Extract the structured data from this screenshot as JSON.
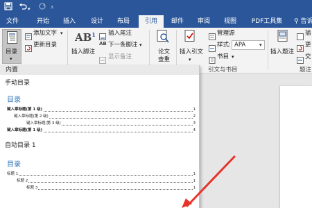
{
  "titlebar": {
    "save_icon": "save-icon",
    "undo_icon": "undo-icon",
    "redo_icon": "redo-icon",
    "customize_icon": "customize-icon",
    "brand_color": "#2b579a"
  },
  "tabs": [
    {
      "label": "文件"
    },
    {
      "label": "开始"
    },
    {
      "label": "插入"
    },
    {
      "label": "设计"
    },
    {
      "label": "布局"
    },
    {
      "label": "引用",
      "active": true
    },
    {
      "label": "邮件"
    },
    {
      "label": "审阅"
    },
    {
      "label": "视图"
    },
    {
      "label": "PDF工具集"
    }
  ],
  "tell_me": "告诉",
  "ribbon": {
    "toc_button": "目录",
    "add_text": "添加文字",
    "update_toc": "更新目录",
    "insert_footnote": "插入脚注",
    "insert_endnote": "插入尾注",
    "next_footnote": "下一条脚注",
    "show_notes": "显示备注",
    "ab_label": "AB",
    "ab_sup": "1",
    "ab_small": "AB",
    "search_l1": "论文",
    "search_l2": "查重",
    "insert_citation": "插入引文",
    "manage_sources": "管理源",
    "style_label": "样式:",
    "style_value": "APA",
    "bibliography": "书目",
    "citations_group": "引文与书目",
    "insert_caption": "插入题注",
    "captions_group": "题注",
    "insert_table_figures": "插",
    "update_table": "更",
    "cross_ref": "交"
  },
  "toc_panel": {
    "builtin_header": "内置",
    "manual_name": "手动目录",
    "manual_heading": "目录",
    "manual_lines": [
      {
        "text": "键入章标题(第 1 级)",
        "page": "1",
        "level": 1,
        "bold": true
      },
      {
        "text": "键入章标题(第 2 级)",
        "page": "2",
        "level": 2,
        "bold": false
      },
      {
        "text": "键入章标题(第 3 级)",
        "page": "3",
        "level": 3,
        "bold": false
      },
      {
        "text": "键入章标题(第 1 级)",
        "page": "4",
        "level": 1,
        "bold": true
      }
    ],
    "auto_name": "自动目录 1",
    "auto_heading": "目录",
    "auto_lines": [
      {
        "text": "标题 1",
        "page": "1",
        "level": 1
      },
      {
        "text": "标题 2",
        "page": "1",
        "level": 2
      },
      {
        "text": "标题 3",
        "page": "1",
        "level": 3
      }
    ]
  },
  "colors": {
    "accent": "#2b579a",
    "toc_heading": "#2e74b5",
    "arrow": "#e8332a"
  }
}
